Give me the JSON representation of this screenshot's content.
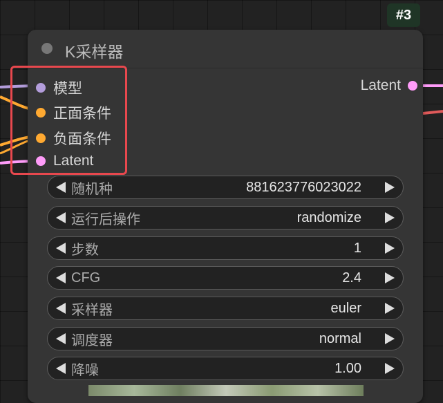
{
  "node": {
    "id_badge": "#3",
    "title": "K采样器",
    "inputs": [
      {
        "label": "模型",
        "color": "#b39ddb"
      },
      {
        "label": "正面条件",
        "color": "#ffa931"
      },
      {
        "label": "负面条件",
        "color": "#ffa931"
      },
      {
        "label": "Latent",
        "color": "#ff9cf9"
      }
    ],
    "output": {
      "label": "Latent",
      "color": "#ff9cf9"
    },
    "widgets": [
      {
        "label": "随机种",
        "value": "881623776023022"
      },
      {
        "label": "运行后操作",
        "value": "randomize"
      },
      {
        "label": "步数",
        "value": "1"
      },
      {
        "label": "CFG",
        "value": "2.4"
      },
      {
        "label": "采样器",
        "value": "euler"
      },
      {
        "label": "调度器",
        "value": "normal"
      },
      {
        "label": "降噪",
        "value": "1.00"
      }
    ]
  },
  "colors": {
    "highlight": "#e8484e",
    "wire_model": "#b39ddb",
    "wire_conditioning": "#ffa931",
    "wire_latent": "#ff9cf9",
    "wire_red": "#e05a5a"
  }
}
